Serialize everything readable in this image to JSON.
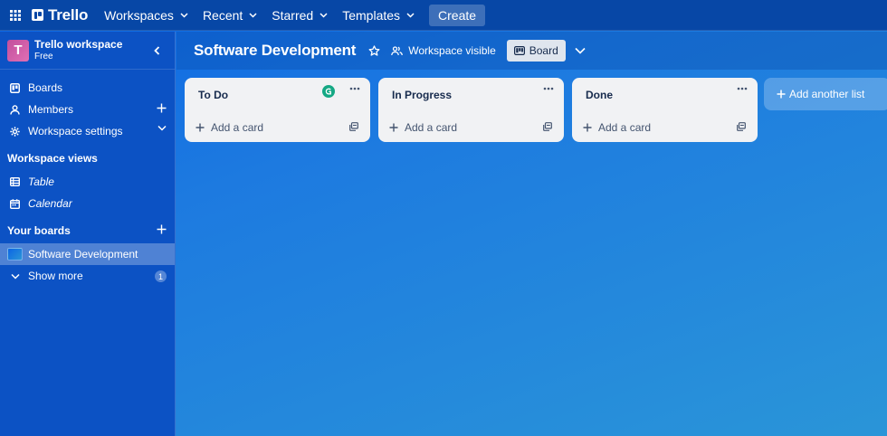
{
  "topbar": {
    "logo_text": "Trello",
    "nav": [
      {
        "label": "Workspaces"
      },
      {
        "label": "Recent"
      },
      {
        "label": "Starred"
      },
      {
        "label": "Templates"
      }
    ],
    "create_label": "Create"
  },
  "sidebar": {
    "workspace_initial": "T",
    "workspace_name": "Trello workspace",
    "workspace_plan": "Free",
    "items": [
      {
        "label": "Boards",
        "icon": "board-icon"
      },
      {
        "label": "Members",
        "icon": "person-icon"
      },
      {
        "label": "Workspace settings",
        "icon": "gear-icon"
      }
    ],
    "views_heading": "Workspace views",
    "views": [
      {
        "label": "Table",
        "icon": "table-icon"
      },
      {
        "label": "Calendar",
        "icon": "calendar-icon"
      }
    ],
    "boards_heading": "Your boards",
    "boards": [
      {
        "label": "Software Development"
      }
    ],
    "show_more_label": "Show more",
    "show_more_count": "1"
  },
  "board": {
    "title": "Software Development",
    "visibility_label": "Workspace visible",
    "view_label": "Board"
  },
  "lists": [
    {
      "title": "To Do",
      "add_card_label": "Add a card"
    },
    {
      "title": "In Progress",
      "add_card_label": "Add a card"
    },
    {
      "title": "Done",
      "add_card_label": "Add a card"
    }
  ],
  "add_list_label": "Add another list",
  "colors": {
    "topbar": "#0747a6",
    "sidebar": "#0c52c4",
    "list_bg": "#f1f2f4",
    "list_text": "#172b4d",
    "workspace_avatar": "#c24f9c",
    "grammarly": "#15a884"
  }
}
